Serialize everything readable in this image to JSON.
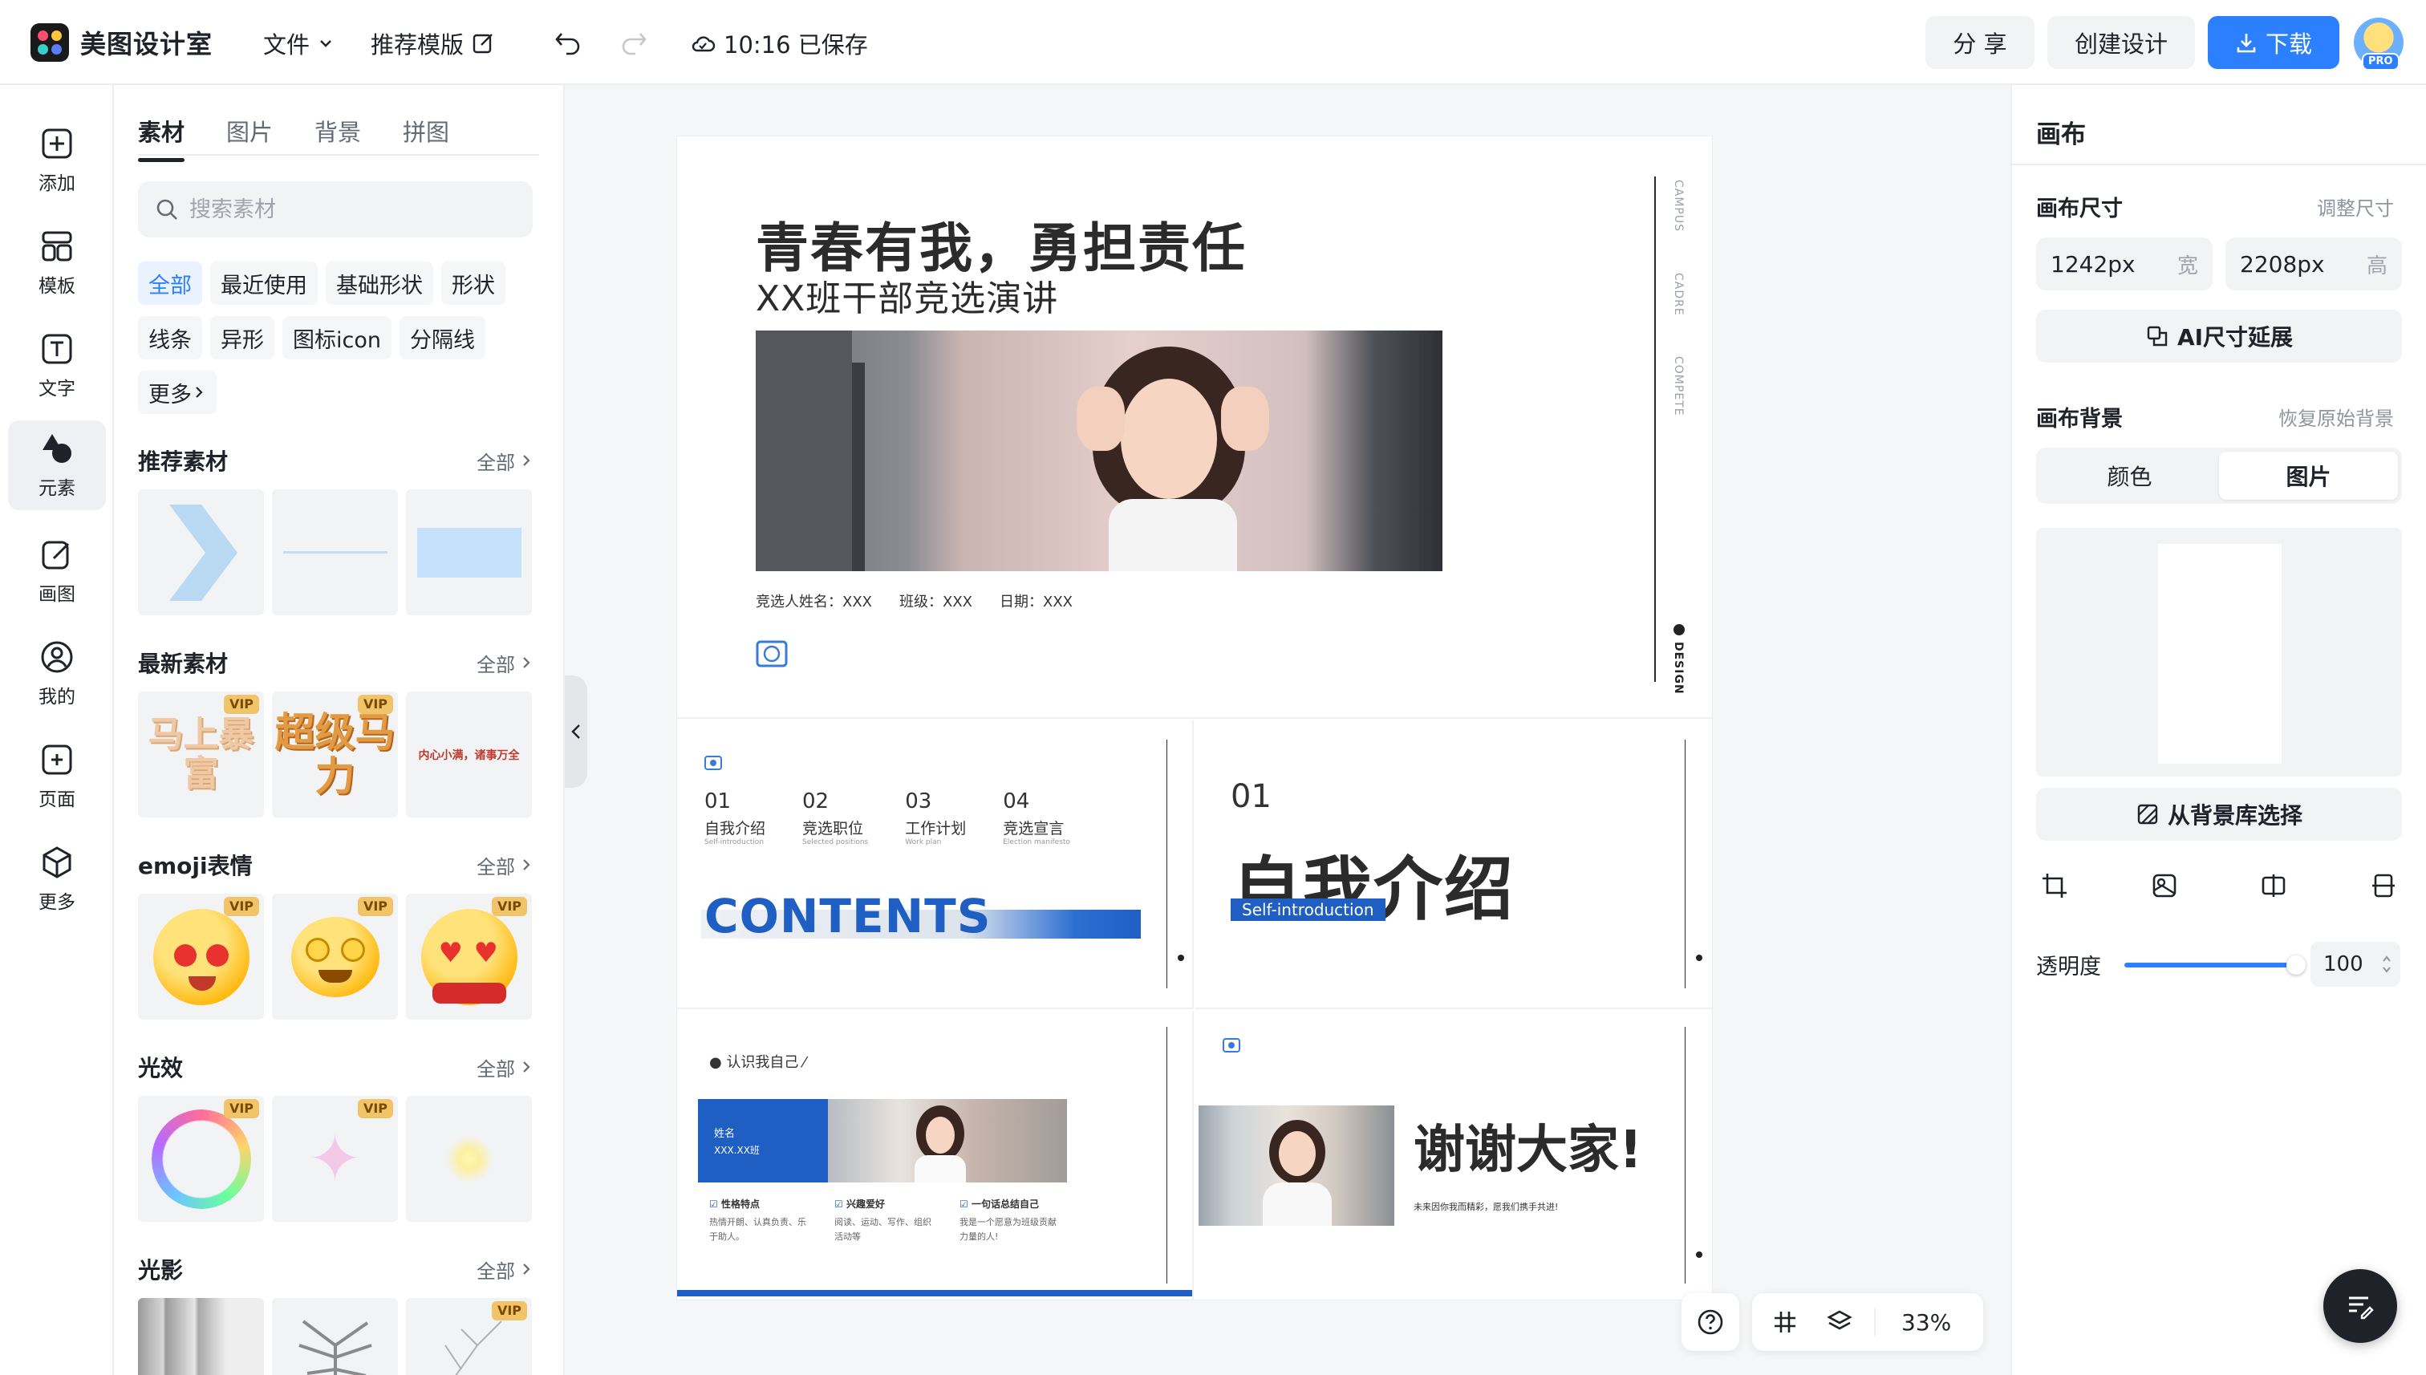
{
  "app": {
    "title": "美图设计室"
  },
  "topbar": {
    "file_menu": "文件",
    "recommend_template": "推荐模版",
    "save_status": "10:16 已保存",
    "share": "分 享",
    "create_design": "创建设计",
    "download": "下载",
    "pro_badge": "PRO"
  },
  "rail": {
    "items": [
      {
        "label": "添加",
        "icon": "plus-square-icon"
      },
      {
        "label": "模板",
        "icon": "template-icon"
      },
      {
        "label": "文字",
        "icon": "text-icon"
      },
      {
        "label": "元素",
        "icon": "shapes-icon"
      },
      {
        "label": "画图",
        "icon": "draw-icon"
      },
      {
        "label": "我的",
        "icon": "user-icon"
      },
      {
        "label": "页面",
        "icon": "page-add-icon"
      },
      {
        "label": "更多",
        "icon": "box-icon"
      }
    ],
    "active_index": 3
  },
  "panel": {
    "tabs": [
      "素材",
      "图片",
      "背景",
      "拼图"
    ],
    "search_placeholder": "搜索素材",
    "chips": [
      "全部",
      "最近使用",
      "基础形状",
      "形状",
      "线条",
      "异形",
      "图标icon",
      "分隔线",
      "更多"
    ],
    "all_label": "全部",
    "vip_label": "VIP",
    "sections": [
      {
        "title": "推荐素材"
      },
      {
        "title": "最新素材",
        "thumbs": [
          "马上暴富",
          "超级马力",
          "内心小满，诸事万全"
        ]
      },
      {
        "title": "emoji表情"
      },
      {
        "title": "光效"
      },
      {
        "title": "光影"
      }
    ]
  },
  "canvas": {
    "cover": {
      "title": "青春有我，勇担责任",
      "subtitle": "XX班干部竞选演讲",
      "meta": [
        "竞选人姓名：XXX",
        "班级：XXX",
        "日期：XXX"
      ],
      "side": [
        "CAMPUS",
        "CADRE",
        "COMPETE",
        "DESIGN"
      ]
    },
    "contents": {
      "items": [
        {
          "num": "01",
          "label": "自我介绍",
          "en": "Self-introduction"
        },
        {
          "num": "02",
          "label": "竞选职位",
          "en": "Selected positions"
        },
        {
          "num": "03",
          "label": "工作计划",
          "en": "Work plan"
        },
        {
          "num": "04",
          "label": "竞选宣言",
          "en": "Election manifesto"
        }
      ],
      "title": "CONTENTS"
    },
    "intro": {
      "num": "01",
      "title": "自我介绍",
      "tag": "Self-introduction"
    },
    "know": {
      "heading": "认识我自己",
      "name_label": "姓名",
      "name_value": "XXX.XX班",
      "cols": [
        {
          "title": "性格特点",
          "text": "热情开朗、认真负责、乐于助人。"
        },
        {
          "title": "兴趣爱好",
          "text": "阅读、运动、写作、组织活动等"
        },
        {
          "title": "一句话总结自己",
          "text": "我是一个愿意为班级贡献力量的人!"
        }
      ]
    },
    "thanks": {
      "title": "谢谢大家!",
      "text": "未来因你我而精彩，愿我们携手共进!"
    }
  },
  "rpanel": {
    "title": "画布",
    "size_label": "画布尺寸",
    "resize_link": "调整尺寸",
    "width_value": "1242px",
    "width_unit": "宽",
    "height_value": "2208px",
    "height_unit": "高",
    "ai_extend": "AI尺寸延展",
    "bg_label": "画布背景",
    "restore_link": "恢复原始背景",
    "seg_color": "颜色",
    "seg_image": "图片",
    "from_library": "从背景库选择",
    "opacity_label": "透明度",
    "opacity_value": "100",
    "opacity_fraction": 1.0
  },
  "bottombar": {
    "zoom": "33%"
  },
  "colors": {
    "accent": "#2c80ff",
    "brand_blue": "#1f5fc4",
    "vip_gold": "#f2c46a"
  }
}
